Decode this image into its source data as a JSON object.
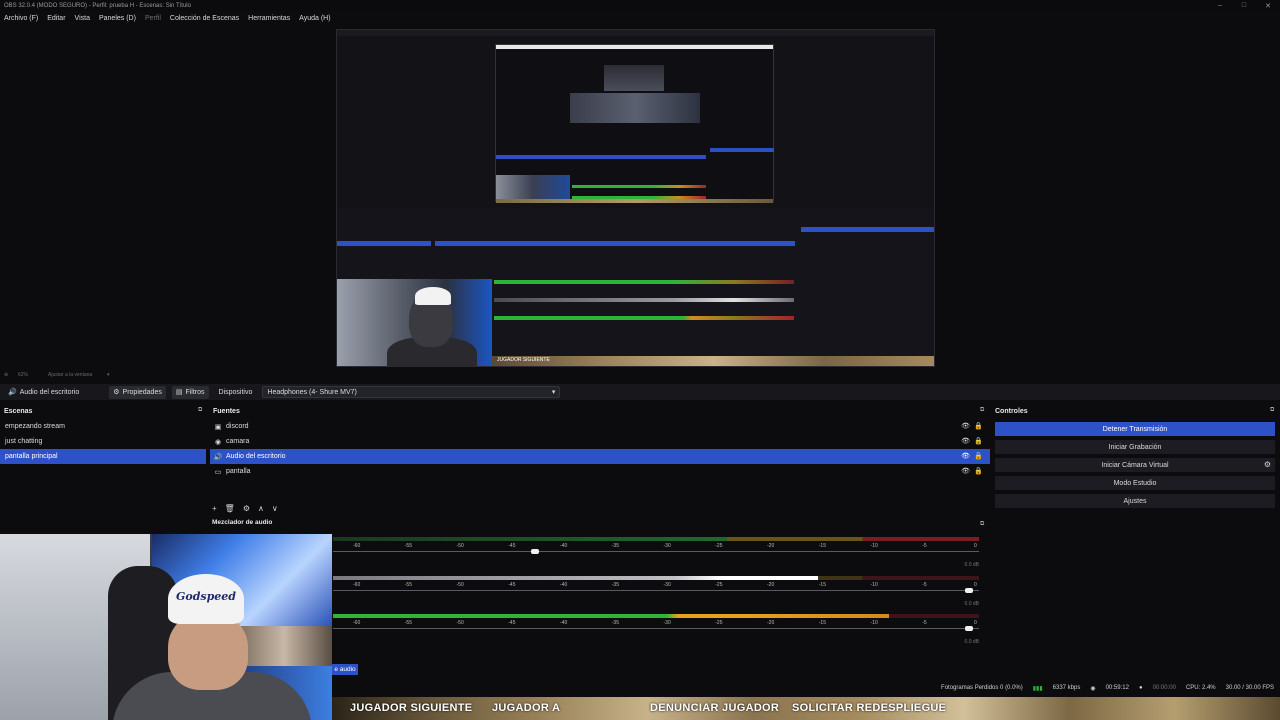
{
  "window": {
    "title": "OBS 32.0.4 (MODO SEGURO) - Perfil: prueba H - Escenas: Sin Título",
    "minimize": "–",
    "maximize": "□",
    "close": "✕"
  },
  "menu": [
    {
      "label": "Archivo (F)",
      "dim": false
    },
    {
      "label": "Editar",
      "dim": false
    },
    {
      "label": "Vista",
      "dim": false
    },
    {
      "label": "Paneles (D)",
      "dim": false
    },
    {
      "label": "Perfil",
      "dim": true
    },
    {
      "label": "Colección de Escenas",
      "dim": false
    },
    {
      "label": "Herramientas",
      "dim": false
    },
    {
      "label": "Ayuda (H)",
      "dim": false
    }
  ],
  "preview": {
    "nested_title": "OBS 32.0.4 (MODO SEGURO) - Perfil: prueba H - Escenas: Sin Título",
    "ground_text": "JUGADOR SIGUIENTE"
  },
  "zoom": {
    "percent": "62%",
    "fit_label": "Ajustar a la ventana"
  },
  "context_bar": {
    "source_name": "Audio del escritorio",
    "properties_label": "Propiedades",
    "filters_label": "Filtros",
    "device_label": "Dispositivo",
    "device_value": "Headphones (4- Shure MV7)"
  },
  "docks": {
    "scenes_title": "Escenas",
    "sources_title": "Fuentes",
    "controls_title": "Controles",
    "mixer_title": "Mezclador de audio"
  },
  "scenes": [
    {
      "label": "empezando stream",
      "selected": false
    },
    {
      "label": "just chatting",
      "selected": false
    },
    {
      "label": "pantalla principal",
      "selected": true
    }
  ],
  "sources": [
    {
      "label": "discord",
      "icon": "window-capture-icon",
      "glyph": "▣",
      "selected": false
    },
    {
      "label": "camara",
      "icon": "camera-icon",
      "glyph": "◉",
      "selected": false
    },
    {
      "label": "Audio del escritorio",
      "icon": "speaker-icon",
      "glyph": "🔊",
      "selected": true
    },
    {
      "label": "pantalla",
      "icon": "display-capture-icon",
      "glyph": "▭",
      "selected": false
    }
  ],
  "source_toolbar": [
    "+",
    "🗑",
    "⚙",
    "∧",
    "∨"
  ],
  "mixer": {
    "ticks": [
      "-60",
      "-55",
      "-50",
      "-45",
      "-40",
      "-35",
      "-30",
      "-25",
      "-20",
      "-15",
      "-10",
      "-5",
      "0"
    ],
    "channels": [
      {
        "db": "0.0 dB",
        "volume_fraction": 0.31,
        "meter_fraction": 0.0
      },
      {
        "db": "0.0 dB",
        "volume_fraction": 0.99,
        "meter_fraction": 0.75
      },
      {
        "db": "0.0 dB",
        "volume_fraction": 0.99,
        "meter_fraction": 0.86
      }
    ],
    "audio_tag": "e audio"
  },
  "controls": [
    {
      "label": "Detener Transmisión",
      "active": true,
      "gear": false
    },
    {
      "label": "Iniciar Grabación",
      "active": false,
      "gear": false
    },
    {
      "label": "Iniciar Cámara Virtual",
      "active": false,
      "gear": true
    },
    {
      "label": "Modo Estudio",
      "active": false,
      "gear": false
    },
    {
      "label": "Ajustes",
      "active": false,
      "gear": false
    }
  ],
  "status": {
    "dropped_frames": "Fotogramas Perdidos 0 (0.0%)",
    "bitrate": "6337 kbps",
    "stream_time": "00:59:12",
    "rec_time": "00:00:00",
    "cpu": "CPU: 2.4%",
    "fps": "30.00 / 30.00 FPS"
  },
  "ground_strip": [
    "JUGADOR SIGUIENTE",
    "JUGADOR A",
    "DENUNCIAR JUGADOR",
    "SOLICITAR REDESPLIEGUE"
  ],
  "webcam": {
    "hat_text": "Godspeed"
  },
  "colors": {
    "accent": "#2d52c8",
    "meter_green": "#2fb43a",
    "meter_yellow": "#c78e1e",
    "meter_red": "#a3222c"
  }
}
